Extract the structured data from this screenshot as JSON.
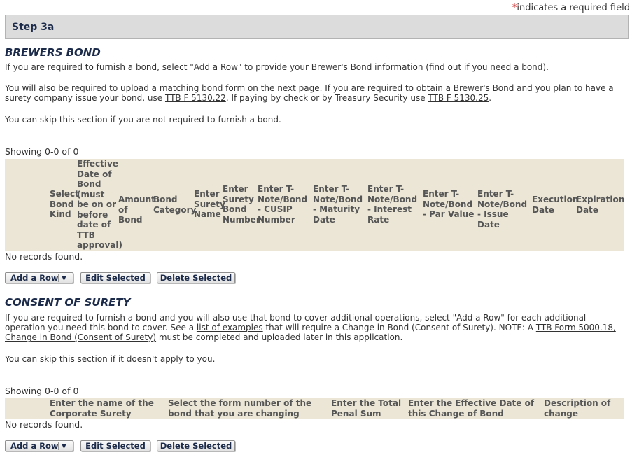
{
  "required_note": {
    "star": "*",
    "text": "indicates a required field"
  },
  "step": {
    "title": "Step 3a"
  },
  "brewers_bond": {
    "title": "BREWERS BOND",
    "p1_before": "If you are required to furnish a bond, select \"Add a Row\" to provide your Brewer's Bond information (",
    "p1_link": "find out if you need a bond",
    "p1_after": ").",
    "p2_before": "You will also be required to upload a matching bond form on the next page. If you are required to obtain a Brewer's Bond and you plan to have a surety company issue your bond, use ",
    "p2_link1": "TTB F 5130.22",
    "p2_mid": ". If paying by check or by Treasury Security use ",
    "p2_link2": "TTB F 5130.25",
    "p2_after": ".",
    "p3": "You can skip this section if you are not required to furnish a bond.",
    "showing": "Showing 0-0 of 0",
    "columns": [
      "Select Bond Kind",
      "Effective Date of Bond (must be on or before date of TTB approval)",
      "Amount of Bond",
      "Bond Category",
      "Enter Surety Name",
      "Enter Surety Bond Number",
      "Enter T-Note/Bond - CUSIP Number",
      "Enter T-Note/Bond - Maturity Date",
      "Enter T-Note/Bond - Interest Rate",
      "Enter T-Note/Bond - Par Value",
      "Enter T-Note/Bond - Issue Date",
      "Execution Date",
      "Expiration Date"
    ],
    "no_records": "No records found.",
    "buttons": {
      "add": "Add a Row",
      "edit": "Edit Selected",
      "delete": "Delete Selected"
    }
  },
  "consent": {
    "title": "CONSENT OF SURETY",
    "p1_before": "If you are required to furnish a bond and you will also use that bond to cover additional operations, select \"Add a Row\" for each additional operation you need this bond to cover. See a ",
    "p1_link1": "list of examples",
    "p1_mid": " that will require a Change in Bond (Consent of Surety). NOTE: A ",
    "p1_link2": "TTB Form 5000.18, Change in Bond (Consent of Surety)",
    "p1_after": " must be completed and uploaded later in this application.",
    "p2": "You can skip this section if it doesn't apply to you.",
    "showing": "Showing 0-0 of 0",
    "columns": [
      "Enter the name of the Corporate Surety",
      "Select the form number of the bond that you are changing",
      "Enter the Total Penal Sum",
      "Enter the Effective Date of this Change of Bond",
      "Description of change"
    ],
    "no_records": "No records found.",
    "buttons": {
      "add": "Add a Row",
      "edit": "Edit Selected",
      "delete": "Delete Selected"
    }
  },
  "icons": {
    "dropdown": "chevron-down-icon"
  }
}
